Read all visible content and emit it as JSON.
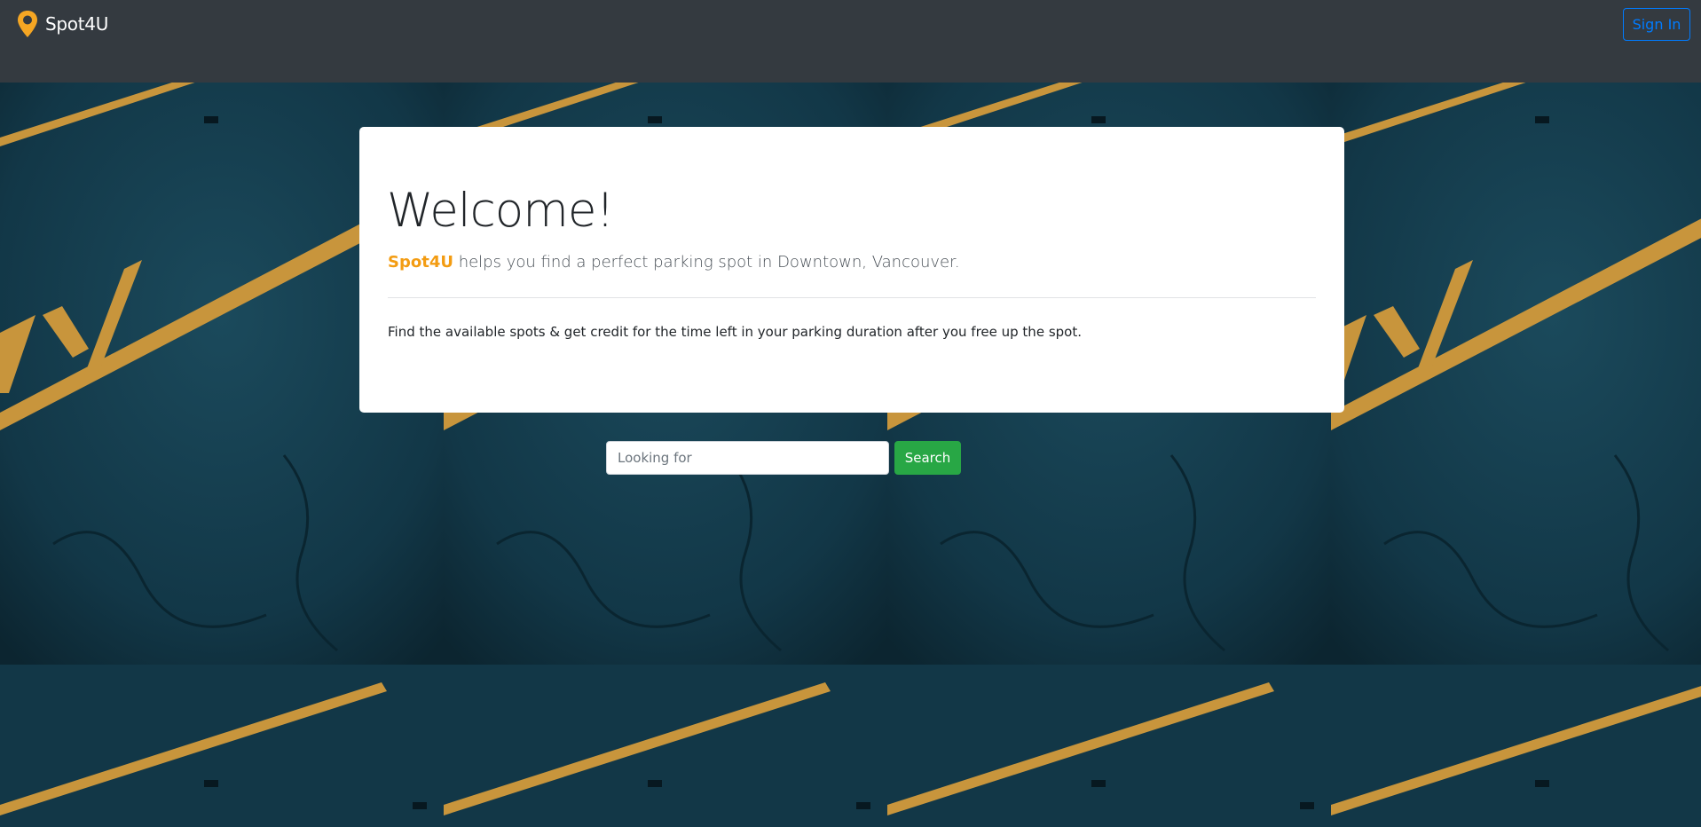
{
  "navbar": {
    "brand": "Spot4U",
    "brand_icon": "map-pin-icon",
    "signin_label": "Sign In"
  },
  "jumbotron": {
    "title": "Welcome!",
    "lead_brand": "Spot4U",
    "lead_text": " helps you find a perfect parking spot in Downtown, Vancouver.",
    "description": "Find the available spots & get credit for the time left in your parking duration after you free up the spot."
  },
  "search": {
    "placeholder": "Looking for",
    "button_label": "Search"
  },
  "colors": {
    "navbar": "#343a40",
    "accent": "#f39c12",
    "primary": "#007bff",
    "success": "#28a745",
    "asphalt": "#123747",
    "stripe": "#c8953c"
  }
}
